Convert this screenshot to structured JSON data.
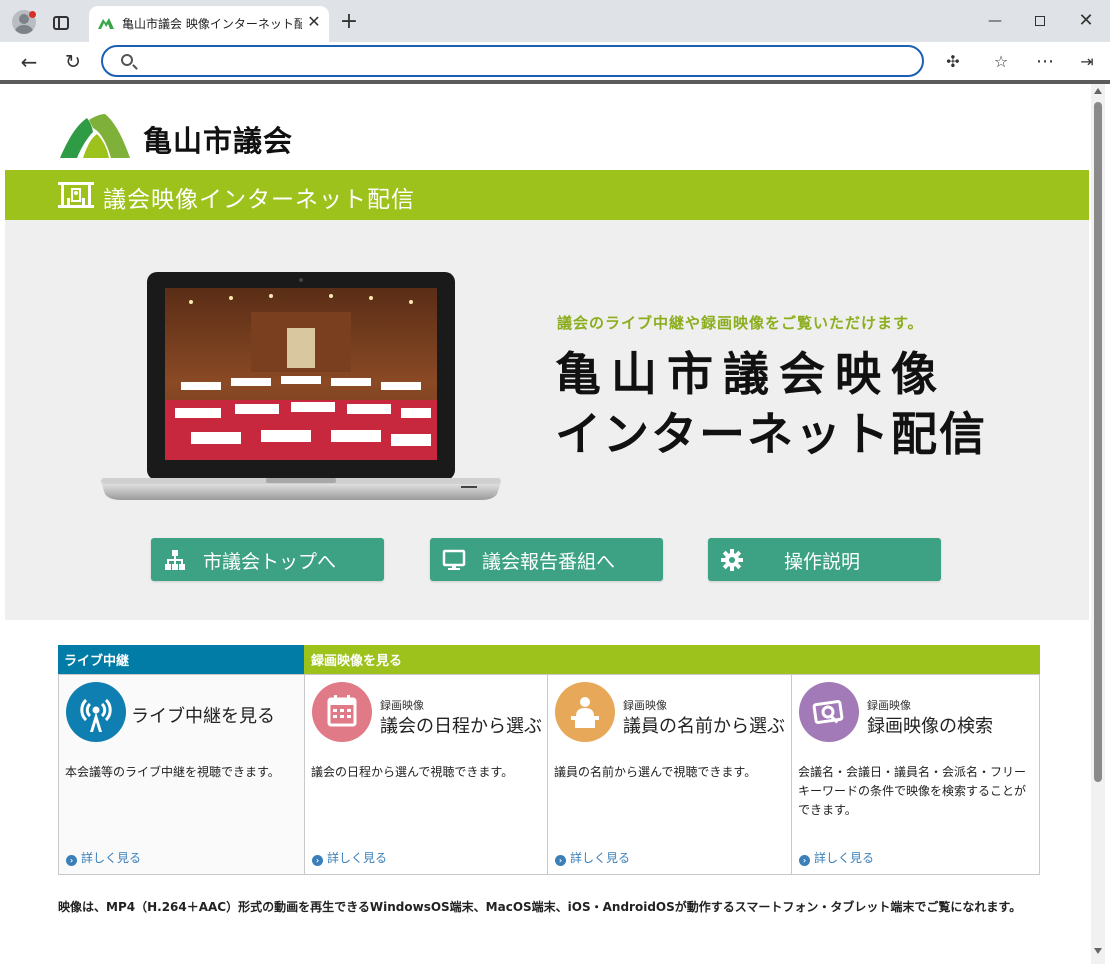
{
  "browser": {
    "tab_title": "亀山市議会 映像インターネット配信",
    "url_value": "",
    "url_placeholder": ""
  },
  "header": {
    "site_name": "亀山市議会",
    "band_title": "議会映像インターネット配信"
  },
  "hero": {
    "tagline": "議会のライブ中継や録画映像をご覧いただけます。",
    "title_line1": "亀山市議会映像",
    "title_line2": "インターネット配信",
    "buttons": [
      {
        "label": "市議会トップへ",
        "icon": "sitemap-icon"
      },
      {
        "label": "議会報告番組へ",
        "icon": "monitor-icon"
      },
      {
        "label": "操作説明",
        "icon": "gear-icon"
      }
    ]
  },
  "menu": {
    "live_heading": "ライブ中継",
    "recorded_heading": "録画映像を見る",
    "cards": [
      {
        "subtitle": "",
        "title": "ライブ中継を見る",
        "description": "本会議等のライブ中継を視聴できます。",
        "more": "詳しく見る",
        "color": "#0e7fb0"
      },
      {
        "subtitle": "録画映像",
        "title": "議会の日程から選ぶ",
        "description": "議会の日程から選んで視聴できます。",
        "more": "詳しく見る",
        "color": "#e07a86"
      },
      {
        "subtitle": "録画映像",
        "title": "議員の名前から選ぶ",
        "description": "議員の名前から選んで視聴できます。",
        "more": "詳しく見る",
        "color": "#e8a85a"
      },
      {
        "subtitle": "録画映像",
        "title": "録画映像の検索",
        "description": "会議名・会議日・議員名・会派名・フリーキーワードの条件で映像を検索することができます。",
        "more": "詳しく見る",
        "color": "#a37ab8"
      }
    ]
  },
  "footnote": "映像は、MP4（H.264＋AAC）形式の動画を再生できるWindowsOS端末、MacOS端末、iOS・AndroidOSが動作するスマートフォン・タブレット端末でご覧になれます。",
  "colors": {
    "green": "#9dc21c",
    "teal_button": "#3da184",
    "live_blue": "#007ca7"
  }
}
